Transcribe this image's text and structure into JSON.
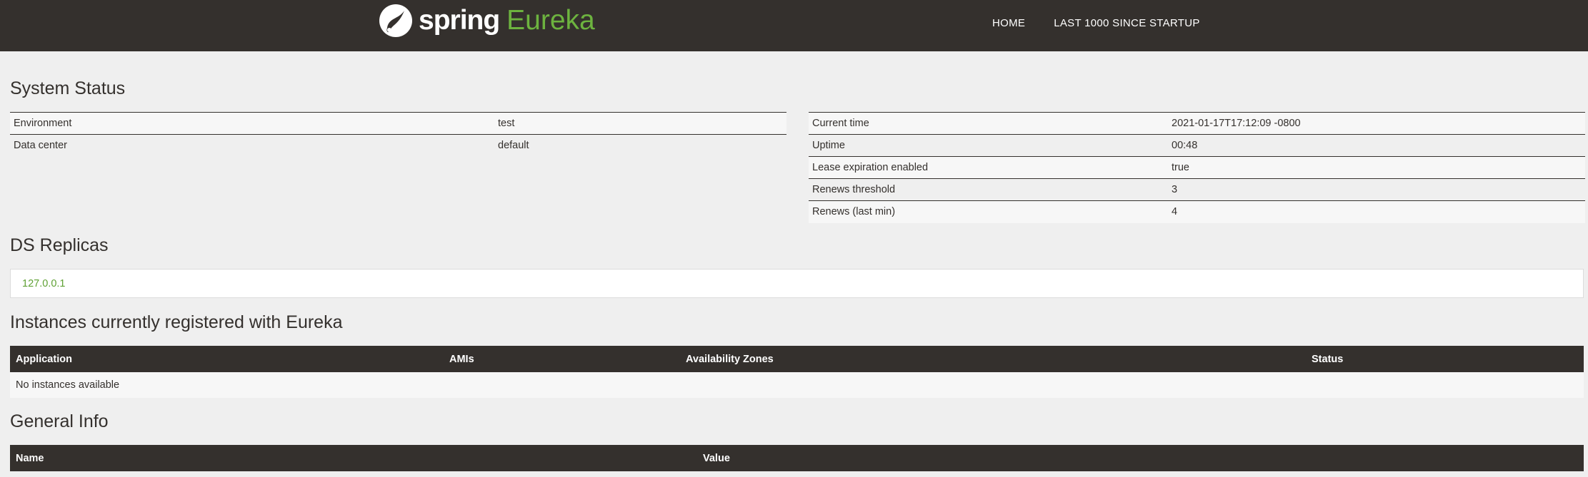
{
  "navbar": {
    "brand_spring": "spring",
    "brand_eureka": "Eureka",
    "links": [
      "HOME",
      "LAST 1000 SINCE STARTUP"
    ]
  },
  "system_status": {
    "heading": "System Status",
    "left": [
      {
        "label": "Environment",
        "value": "test"
      },
      {
        "label": "Data center",
        "value": "default"
      }
    ],
    "right": [
      {
        "label": "Current time",
        "value": "2021-01-17T17:12:09 -0800"
      },
      {
        "label": "Uptime",
        "value": "00:48"
      },
      {
        "label": "Lease expiration enabled",
        "value": "true"
      },
      {
        "label": "Renews threshold",
        "value": "3"
      },
      {
        "label": "Renews (last min)",
        "value": "4"
      }
    ]
  },
  "ds_replicas": {
    "heading": "DS Replicas",
    "items": [
      "127.0.0.1"
    ]
  },
  "instances": {
    "heading": "Instances currently registered with Eureka",
    "columns": [
      "Application",
      "AMIs",
      "Availability Zones",
      "Status"
    ],
    "empty_text": "No instances available"
  },
  "general_info": {
    "heading": "General Info",
    "columns": [
      "Name",
      "Value"
    ]
  },
  "colors": {
    "navbar_bg": "#34302d",
    "accent_green": "#6db33f",
    "page_bg": "#efefef"
  }
}
